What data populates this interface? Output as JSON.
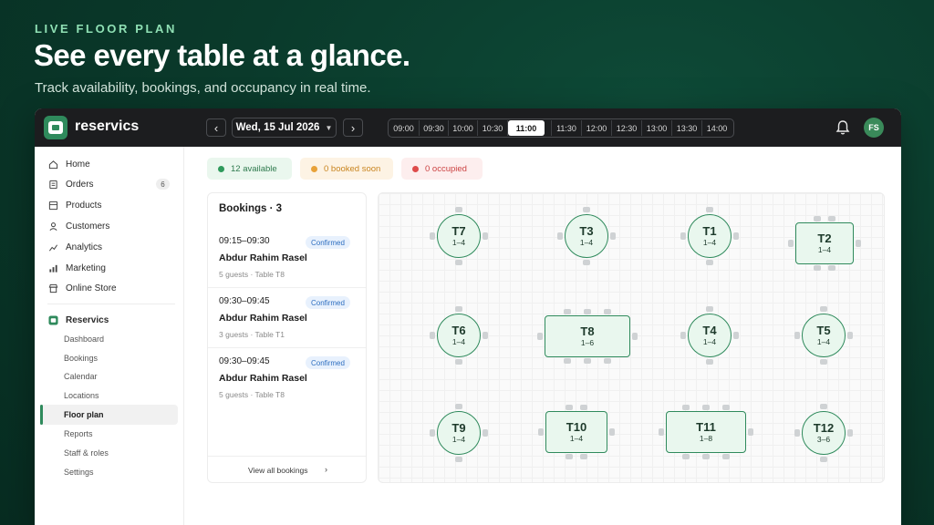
{
  "hero": {
    "eyebrow": "LIVE FLOOR PLAN",
    "headline": "See every table at a glance.",
    "subline": "Track availability, bookings, and occupancy in real time."
  },
  "topbar": {
    "brand": "reservics",
    "prev": "‹",
    "next": "›",
    "date": "Wed, 15 Jul 2026",
    "times": [
      "09:00",
      "09:30",
      "10:00",
      "10:30",
      "11:00",
      "11:30",
      "12:00",
      "12:30",
      "13:00",
      "13:30",
      "14:00"
    ],
    "active_time": "11:00",
    "avatar_initials": "FS"
  },
  "sidebar": {
    "items": [
      {
        "label": "Home",
        "icon": "home-icon"
      },
      {
        "label": "Orders",
        "icon": "orders-icon",
        "badge": "6"
      },
      {
        "label": "Products",
        "icon": "products-icon"
      },
      {
        "label": "Customers",
        "icon": "customers-icon"
      },
      {
        "label": "Analytics",
        "icon": "analytics-icon"
      },
      {
        "label": "Marketing",
        "icon": "marketing-icon"
      },
      {
        "label": "Online Store",
        "icon": "store-icon"
      }
    ],
    "app_section": "Reservics",
    "sub_items": [
      "Dashboard",
      "Bookings",
      "Calendar",
      "Locations",
      "Floor plan",
      "Reports",
      "Staff & roles",
      "Settings"
    ],
    "active_sub": "Floor plan"
  },
  "status": {
    "available": "12 available",
    "booked": "0 booked soon",
    "occupied": "0 occupied",
    "colors": {
      "available": "#2f9a5c",
      "booked": "#e8a23a",
      "occupied": "#de4b4b"
    }
  },
  "bookings": {
    "title": "Bookings · 3",
    "items": [
      {
        "time": "09:15–09:30",
        "status": "Confirmed",
        "name": "Abdur Rahim Rasel",
        "detail": "5 guests · Table T8"
      },
      {
        "time": "09:30–09:45",
        "status": "Confirmed",
        "name": "Abdur Rahim Rasel",
        "detail": "3 guests · Table T1"
      },
      {
        "time": "09:30–09:45",
        "status": "Confirmed",
        "name": "Abdur Rahim Rasel",
        "detail": "5 guests · Table T8"
      }
    ],
    "view_all": "View all bookings",
    "chevron": "›"
  },
  "floor": {
    "tables": [
      {
        "name": "T7",
        "seats": "1–4"
      },
      {
        "name": "T3",
        "seats": "1–4"
      },
      {
        "name": "T1",
        "seats": "1–4"
      },
      {
        "name": "T2",
        "seats": "1–4"
      },
      {
        "name": "T6",
        "seats": "1–4"
      },
      {
        "name": "T8",
        "seats": "1–6"
      },
      {
        "name": "T4",
        "seats": "1–4"
      },
      {
        "name": "T5",
        "seats": "1–4"
      },
      {
        "name": "T9",
        "seats": "1–4"
      },
      {
        "name": "T10",
        "seats": "1–4"
      },
      {
        "name": "T11",
        "seats": "1–8"
      },
      {
        "name": "T12",
        "seats": "3–6"
      }
    ]
  }
}
